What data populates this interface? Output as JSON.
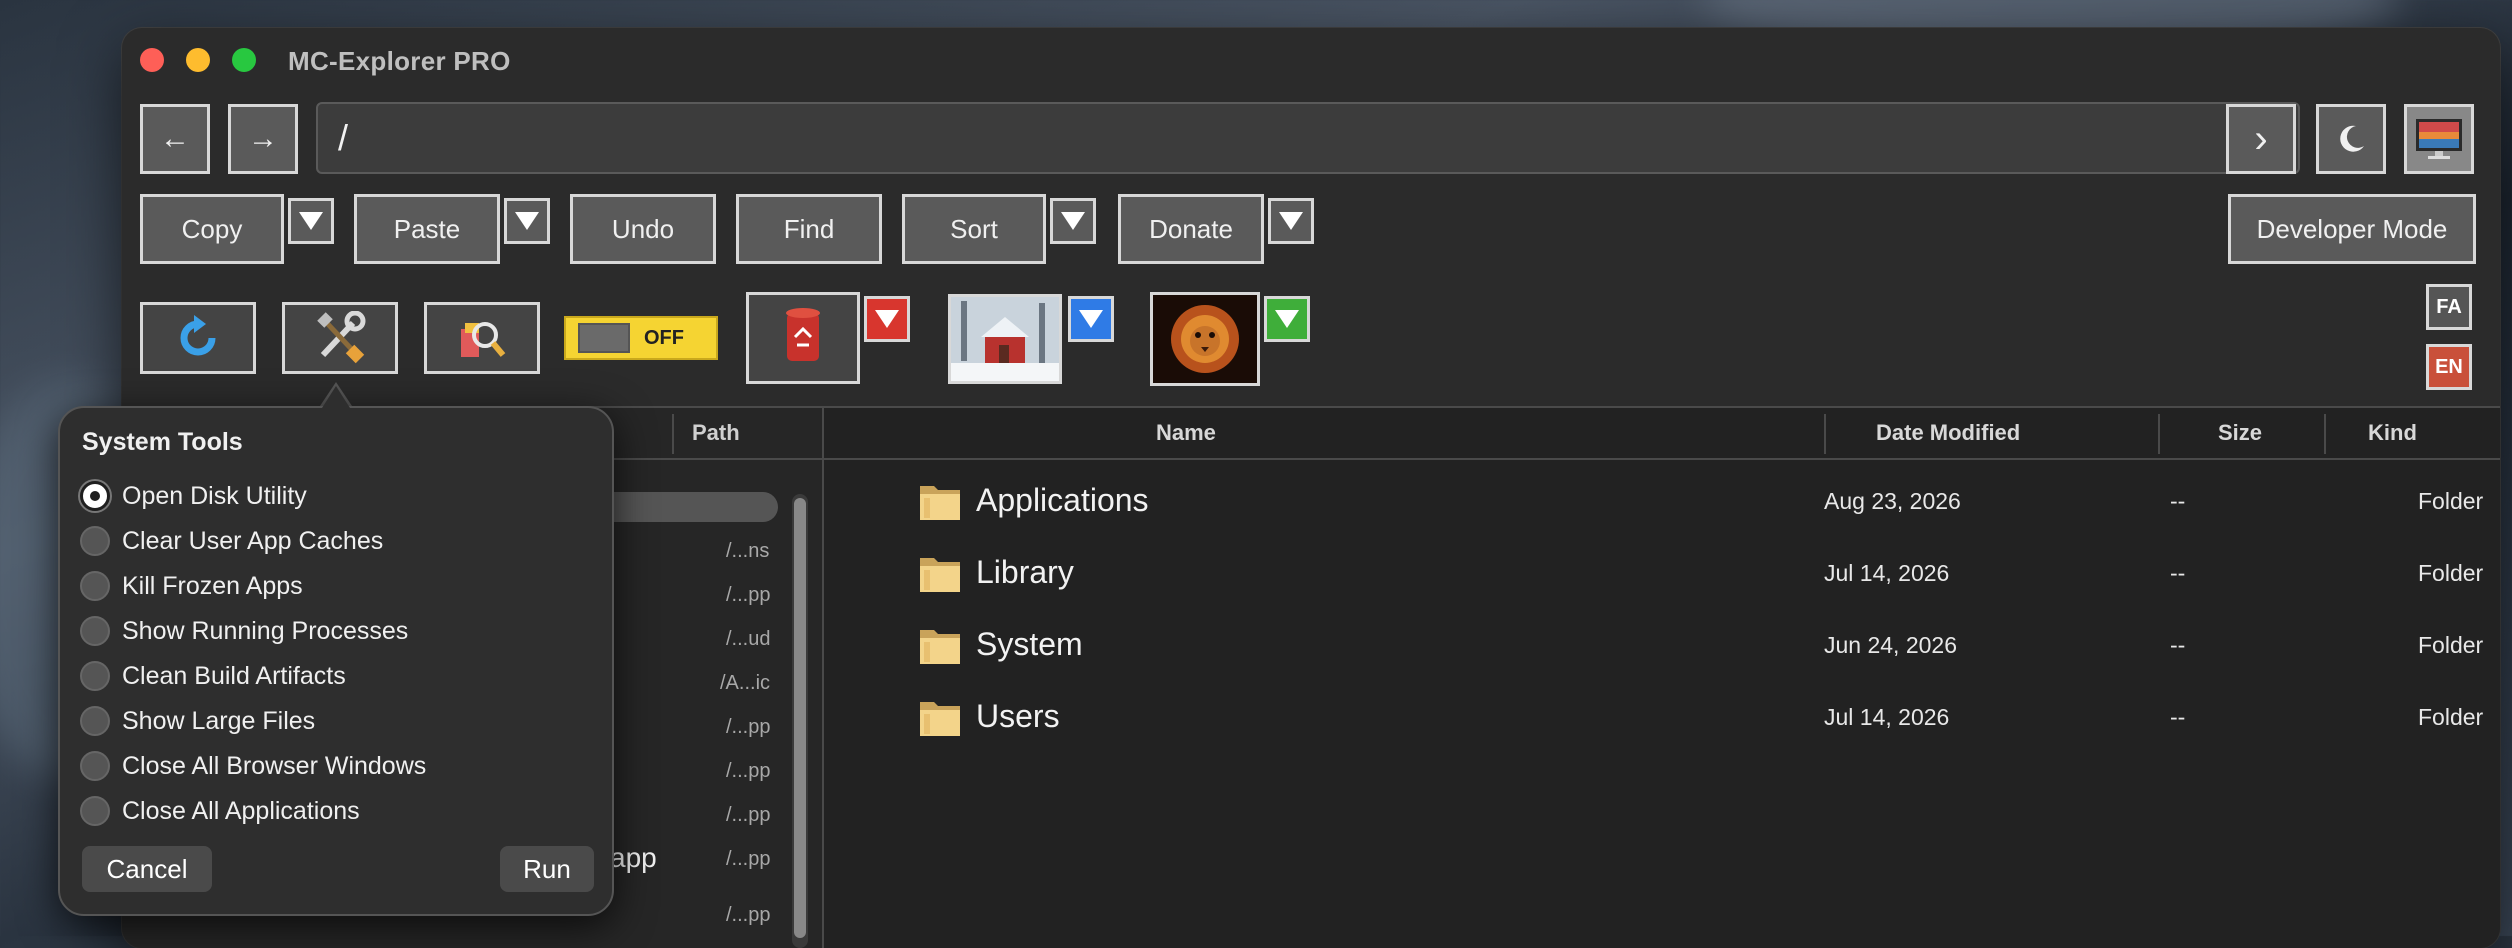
{
  "window": {
    "title": "MC-Explorer PRO"
  },
  "nav": {
    "path": "/",
    "back_icon": "←",
    "forward_icon": "→",
    "go_icon": "›"
  },
  "toolbar": {
    "copy": "Copy",
    "paste": "Paste",
    "undo": "Undo",
    "find": "Find",
    "sort": "Sort",
    "donate": "Donate",
    "developer_mode": "Developer Mode"
  },
  "toggle": {
    "label": "OFF"
  },
  "lang": {
    "fa": "FA",
    "en": "EN"
  },
  "left_panel": {
    "path_header": "Path",
    "paths": [
      "/...ns",
      "/...pp",
      "/...ud",
      "/A...ic",
      "/...pp",
      "/...pp",
      "/...pp",
      "/...pp",
      "/...pp"
    ],
    "partial_item": "app"
  },
  "file_list": {
    "headers": {
      "name": "Name",
      "date": "Date Modified",
      "size": "Size",
      "kind": "Kind"
    },
    "rows": [
      {
        "name": "Applications",
        "date": "Aug 23, 2026",
        "size": "--",
        "kind": "Folder"
      },
      {
        "name": "Library",
        "date": "Jul 14, 2026",
        "size": "--",
        "kind": "Folder"
      },
      {
        "name": "System",
        "date": "Jun 24, 2026",
        "size": "--",
        "kind": "Folder"
      },
      {
        "name": "Users",
        "date": "Jul 14, 2026",
        "size": "--",
        "kind": "Folder"
      }
    ]
  },
  "system_tools": {
    "title": "System Tools",
    "options": [
      "Open Disk Utility",
      "Clear User App Caches",
      "Kill Frozen Apps",
      "Show Running Processes",
      "Clean Build Artifacts",
      "Show Large Files",
      "Close All Browser Windows",
      "Close All Applications"
    ],
    "selected": "Open Disk Utility",
    "cancel": "Cancel",
    "run": "Run"
  },
  "colors": {
    "accent_red": "#d8362e",
    "accent_blue": "#2f7be6",
    "accent_green": "#3fae3a",
    "toggle_yellow": "#f5d432",
    "lang_en": "#c9503a"
  }
}
